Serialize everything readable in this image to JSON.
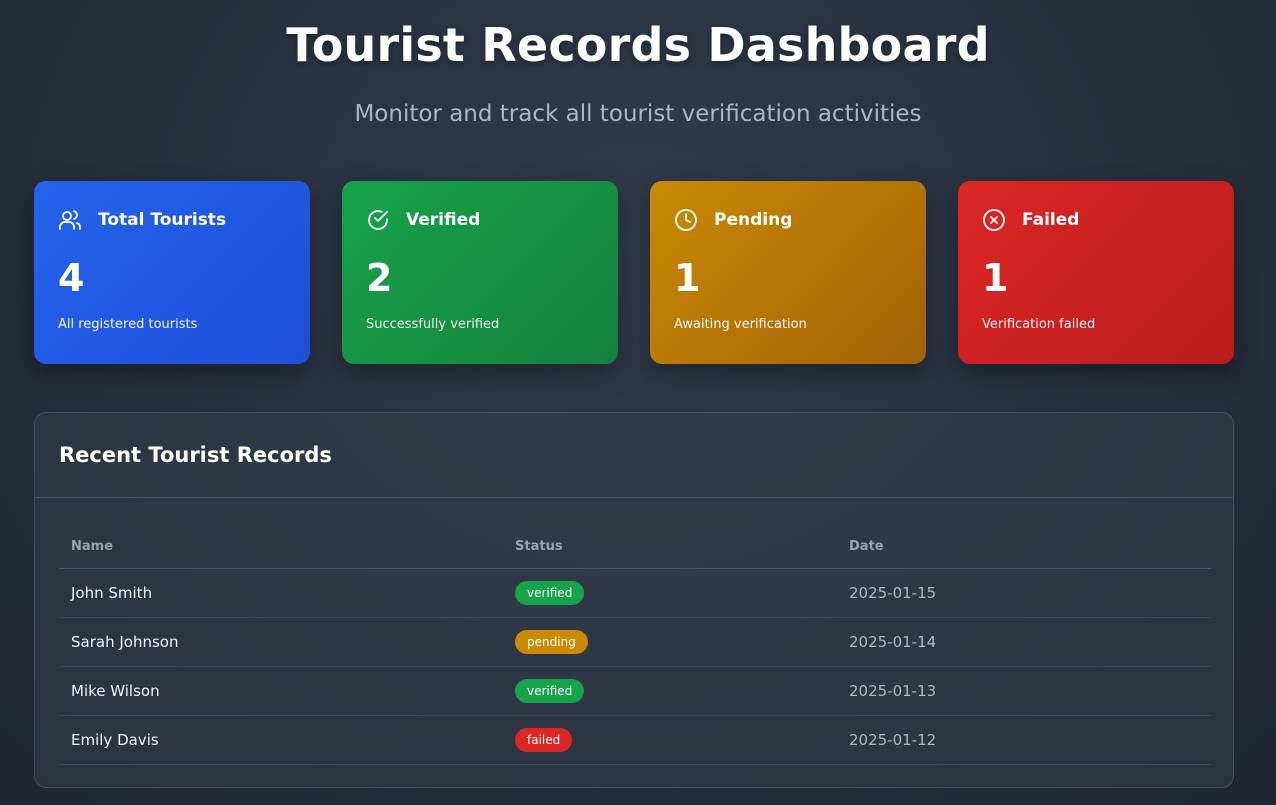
{
  "header": {
    "title": "Tourist Records Dashboard",
    "subtitle": "Monitor and track all tourist verification activities"
  },
  "stats": [
    {
      "icon": "users-icon",
      "label": "Total Tourists",
      "value": "4",
      "description": "All registered tourists",
      "color": "#2563eb"
    },
    {
      "icon": "check-circle-icon",
      "label": "Verified",
      "value": "2",
      "description": "Successfully verified",
      "color": "#16a34a"
    },
    {
      "icon": "clock-icon",
      "label": "Pending",
      "value": "1",
      "description": "Awaiting verification",
      "color": "#ca8a04"
    },
    {
      "icon": "x-circle-icon",
      "label": "Failed",
      "value": "1",
      "description": "Verification failed",
      "color": "#dc2626"
    }
  ],
  "records": {
    "title": "Recent Tourist Records",
    "columns": [
      "Name",
      "Status",
      "Date"
    ],
    "rows": [
      {
        "name": "John Smith",
        "status": "verified",
        "date": "2025-01-15"
      },
      {
        "name": "Sarah Johnson",
        "status": "pending",
        "date": "2025-01-14"
      },
      {
        "name": "Mike Wilson",
        "status": "verified",
        "date": "2025-01-13"
      },
      {
        "name": "Emily Davis",
        "status": "failed",
        "date": "2025-01-12"
      }
    ]
  },
  "status_colors": {
    "verified": "#16a34a",
    "pending": "#ca8a04",
    "failed": "#dc2626"
  }
}
